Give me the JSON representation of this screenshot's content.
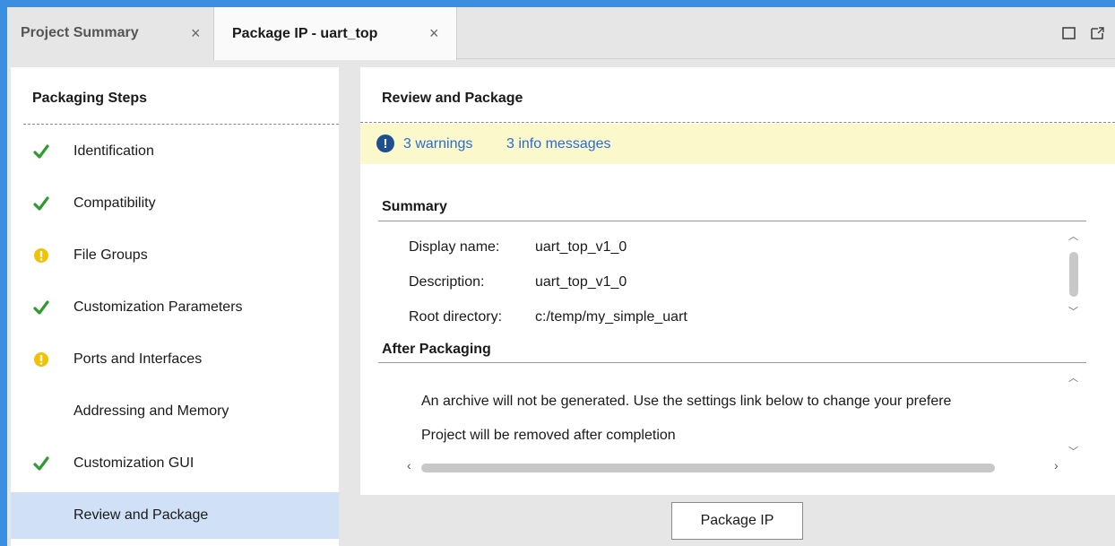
{
  "tabs": [
    {
      "label": "Project Summary",
      "active": false
    },
    {
      "label": "Package IP - uart_top",
      "active": true
    }
  ],
  "tab_close_glyph": "×",
  "left": {
    "title": "Packaging Steps",
    "steps": [
      {
        "label": "Identification",
        "status": "check-icon"
      },
      {
        "label": "Compatibility",
        "status": "check-icon"
      },
      {
        "label": "File Groups",
        "status": "warning-icon"
      },
      {
        "label": "Customization Parameters",
        "status": "check-icon"
      },
      {
        "label": "Ports and Interfaces",
        "status": "warning-icon"
      },
      {
        "label": "Addressing and Memory",
        "status": "none"
      },
      {
        "label": "Customization GUI",
        "status": "check-icon"
      },
      {
        "label": "Review and Package",
        "status": "none",
        "selected": true
      }
    ]
  },
  "right": {
    "title": "Review and Package",
    "banner": {
      "warnings": "3 warnings",
      "info": "3 info messages"
    },
    "summary": {
      "title": "Summary",
      "rows": [
        {
          "key": "Display name:",
          "value": "uart_top_v1_0"
        },
        {
          "key": "Description:",
          "value": "uart_top_v1_0"
        },
        {
          "key": "Root directory:",
          "value": "c:/temp/my_simple_uart"
        }
      ]
    },
    "after": {
      "title": "After Packaging",
      "lines": [
        "An archive will not be generated. Use the settings link below to change your prefere",
        "Project will be removed after completion"
      ]
    }
  },
  "package_button": "Package IP",
  "colors": {
    "accent": "#3c8ee0",
    "check": "#2e9b2e",
    "warning": "#f2c200",
    "link": "#2a6bd6",
    "selected": "#cfe0f7",
    "banner": "#fbf8cc"
  }
}
